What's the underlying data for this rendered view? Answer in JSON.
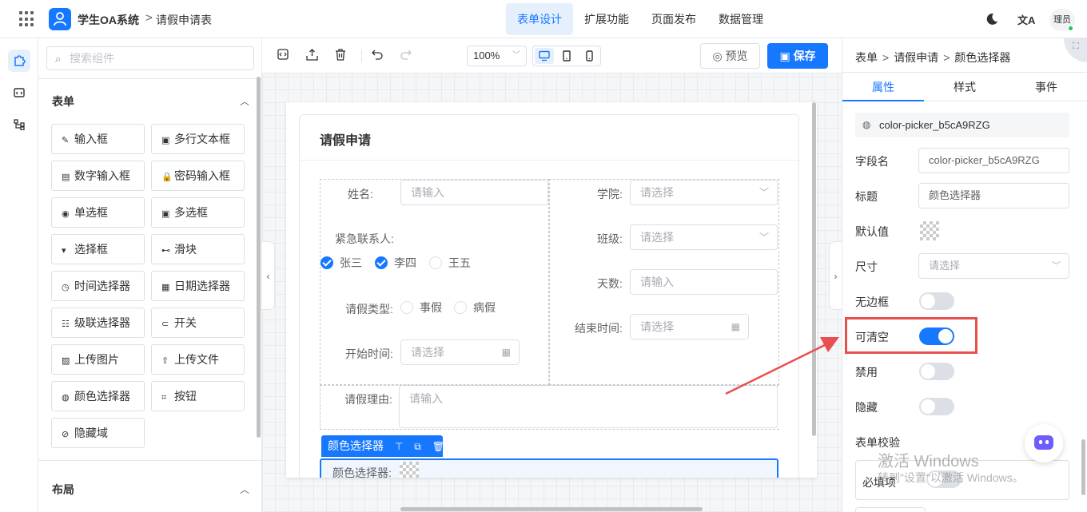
{
  "header": {
    "app_name": "学生OA系统",
    "breadcrumb_sep": ">",
    "page_name": "请假申请表",
    "nav": [
      "表单设计",
      "扩展功能",
      "页面发布",
      "数据管理"
    ],
    "active_nav": "表单设计",
    "avatar_text": "理员",
    "translate_icon": "文A"
  },
  "rail": {
    "items": [
      "puzzle-icon",
      "code-icon",
      "tree-icon"
    ]
  },
  "components": {
    "search_placeholder": "搜索组件",
    "form_group_title": "表单",
    "layout_group_title": "布局",
    "items": [
      {
        "label": "输入框",
        "icon": "✎"
      },
      {
        "label": "多行文本框",
        "icon": "▣"
      },
      {
        "label": "数字输入框",
        "icon": "▤"
      },
      {
        "label": "密码输入框",
        "icon": "🔒"
      },
      {
        "label": "单选框",
        "icon": "◉"
      },
      {
        "label": "多选框",
        "icon": "▣"
      },
      {
        "label": "选择框",
        "icon": "▾"
      },
      {
        "label": "滑块",
        "icon": "⊷"
      },
      {
        "label": "时间选择器",
        "icon": "◷"
      },
      {
        "label": "日期选择器",
        "icon": "▦"
      },
      {
        "label": "级联选择器",
        "icon": "☷"
      },
      {
        "label": "开关",
        "icon": "⊂"
      },
      {
        "label": "上传图片",
        "icon": "▨"
      },
      {
        "label": "上传文件",
        "icon": "⇧"
      },
      {
        "label": "颜色选择器",
        "icon": "◍"
      },
      {
        "label": "按钮",
        "icon": "⌗"
      },
      {
        "label": "隐藏域",
        "icon": "⊘"
      }
    ]
  },
  "toolbar": {
    "zoom": "100%",
    "preview_label": "预览",
    "save_label": "保存"
  },
  "form": {
    "title": "请假申请",
    "name_label": "姓名:",
    "name_placeholder": "请输入",
    "college_label": "学院:",
    "college_placeholder": "请选择",
    "emergency_label": "紧急联系人:",
    "contacts": [
      {
        "label": "张三",
        "checked": true
      },
      {
        "label": "李四",
        "checked": true
      },
      {
        "label": "王五",
        "checked": false
      }
    ],
    "class_label": "班级:",
    "class_placeholder": "请选择",
    "days_label": "天数:",
    "days_placeholder": "请输入",
    "leave_type_label": "请假类型:",
    "leave_types": [
      "事假",
      "病假"
    ],
    "end_time_label": "结束时间:",
    "end_time_placeholder": "请选择",
    "start_time_label": "开始时间:",
    "start_time_placeholder": "请选择",
    "reason_label": "请假理由:",
    "reason_placeholder": "请输入",
    "selected_tag": "颜色选择器",
    "color_label": "颜色选择器:"
  },
  "props": {
    "breadcrumb": [
      "表单",
      "请假申请",
      "颜色选择器"
    ],
    "tabs": [
      "属性",
      "样式",
      "事件"
    ],
    "active_tab": "属性",
    "component_id": "color-picker_b5cA9RZG",
    "field_name_label": "字段名",
    "field_name_value": "color-picker_b5cA9RZG",
    "title_label": "标题",
    "title_value": "颜色选择器",
    "default_label": "默认值",
    "size_label": "尺寸",
    "size_placeholder": "请选择",
    "borderless_label": "无边框",
    "borderless_on": false,
    "clearable_label": "可清空",
    "clearable_on": true,
    "disabled_label": "禁用",
    "disabled_on": false,
    "hidden_label": "隐藏",
    "hidden_on": false,
    "validation_label": "表单校验",
    "required_label": "必填项",
    "required_on": false
  },
  "watermark": {
    "line1": "激活 Windows",
    "line2": "转到\"设置\"以激活 Windows。"
  },
  "colors": {
    "primary": "#1677ff",
    "highlight": "#e94f4f",
    "primary_light": "#e6f0fd"
  }
}
